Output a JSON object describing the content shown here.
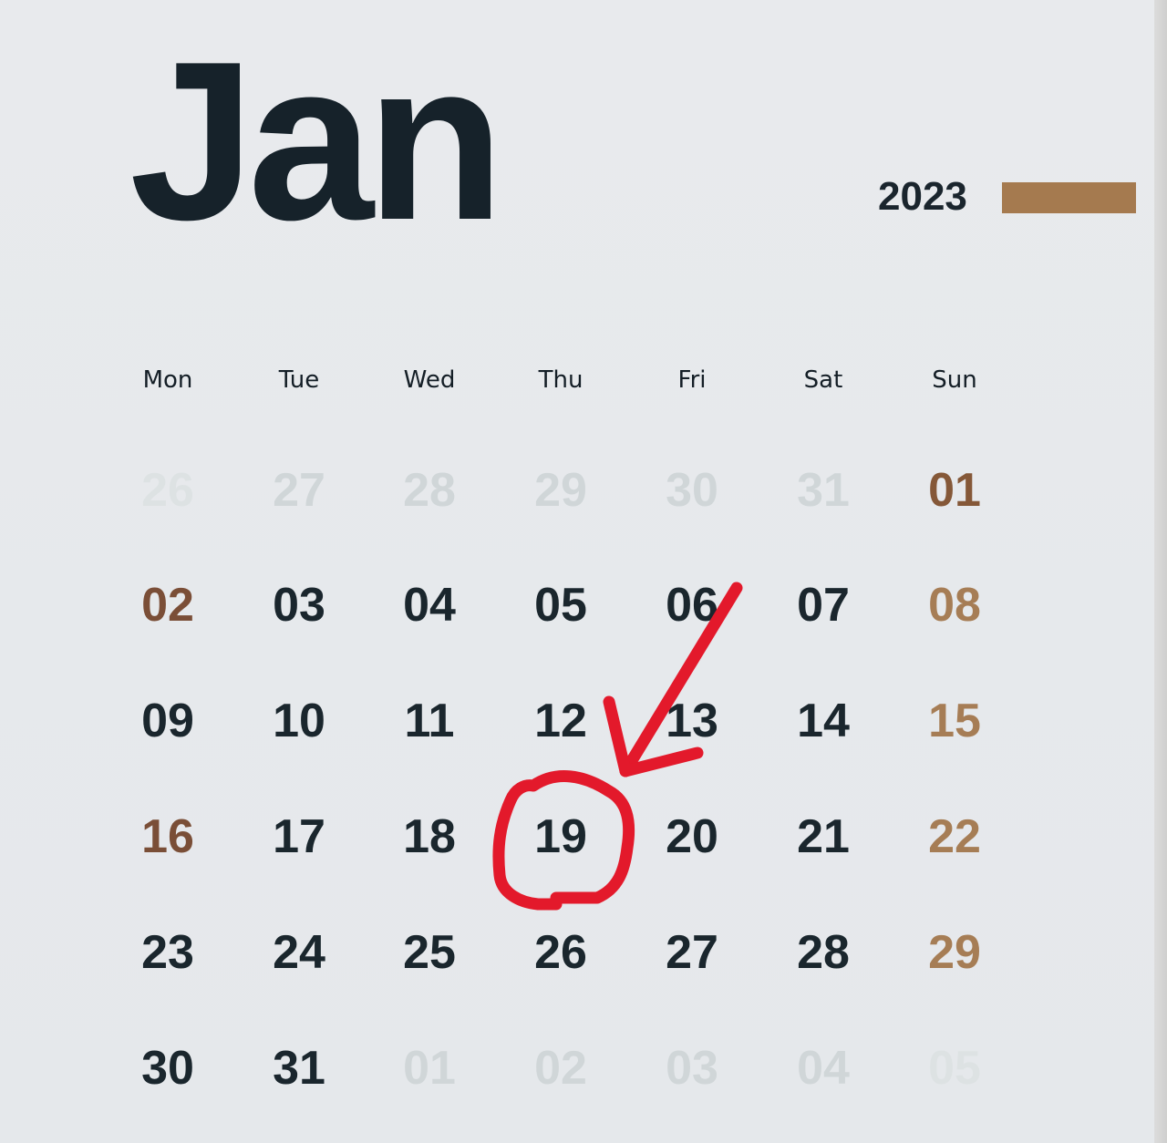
{
  "calendar": {
    "month": "Jan",
    "year": "2023",
    "accent_bar_color": "#a57a4f",
    "weekdays": [
      "Mon",
      "Tue",
      "Wed",
      "Thu",
      "Fri",
      "Sat",
      "Sun"
    ],
    "weeks": [
      [
        {
          "label": "26",
          "style": "faded-light"
        },
        {
          "label": "27",
          "style": "faded"
        },
        {
          "label": "28",
          "style": "faded"
        },
        {
          "label": "29",
          "style": "faded"
        },
        {
          "label": "30",
          "style": "faded"
        },
        {
          "label": "31",
          "style": "faded"
        },
        {
          "label": "01",
          "style": "sun-first"
        }
      ],
      [
        {
          "label": "02",
          "style": "mon-accent"
        },
        {
          "label": "03",
          "style": "normal"
        },
        {
          "label": "04",
          "style": "normal"
        },
        {
          "label": "05",
          "style": "normal"
        },
        {
          "label": "06",
          "style": "normal"
        },
        {
          "label": "07",
          "style": "normal"
        },
        {
          "label": "08",
          "style": "sun-accent"
        }
      ],
      [
        {
          "label": "09",
          "style": "normal"
        },
        {
          "label": "10",
          "style": "normal"
        },
        {
          "label": "11",
          "style": "normal"
        },
        {
          "label": "12",
          "style": "normal"
        },
        {
          "label": "13",
          "style": "normal"
        },
        {
          "label": "14",
          "style": "normal"
        },
        {
          "label": "15",
          "style": "sun-accent"
        }
      ],
      [
        {
          "label": "16",
          "style": "mon-accent"
        },
        {
          "label": "17",
          "style": "normal"
        },
        {
          "label": "18",
          "style": "normal"
        },
        {
          "label": "19",
          "style": "normal",
          "circled": true
        },
        {
          "label": "20",
          "style": "normal"
        },
        {
          "label": "21",
          "style": "normal"
        },
        {
          "label": "22",
          "style": "sun-accent"
        }
      ],
      [
        {
          "label": "23",
          "style": "normal"
        },
        {
          "label": "24",
          "style": "normal"
        },
        {
          "label": "25",
          "style": "normal"
        },
        {
          "label": "26",
          "style": "normal"
        },
        {
          "label": "27",
          "style": "normal"
        },
        {
          "label": "28",
          "style": "normal"
        },
        {
          "label": "29",
          "style": "sun-accent"
        }
      ],
      [
        {
          "label": "30",
          "style": "normal"
        },
        {
          "label": "31",
          "style": "normal"
        },
        {
          "label": "01",
          "style": "faded"
        },
        {
          "label": "02",
          "style": "faded"
        },
        {
          "label": "03",
          "style": "faded"
        },
        {
          "label": "04",
          "style": "faded"
        },
        {
          "label": "05",
          "style": "faded-light"
        }
      ]
    ]
  },
  "annotation": {
    "marked_date": "19",
    "color": "#e3192b",
    "shapes": [
      "hand-drawn-circle",
      "arrow"
    ]
  }
}
